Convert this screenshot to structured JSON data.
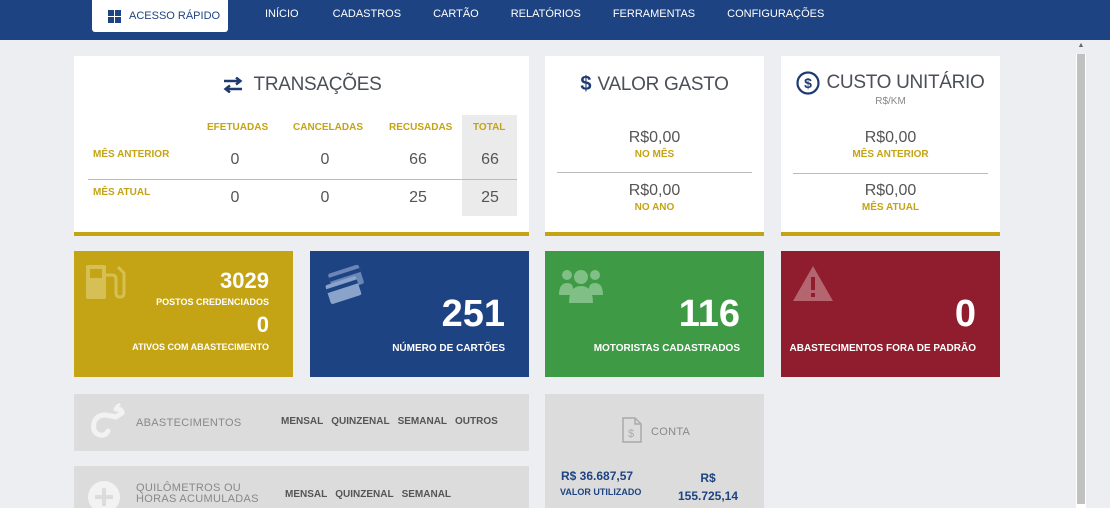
{
  "nav": {
    "quick_access": "ACESSO RÁPIDO",
    "items": [
      "INÍCIO",
      "CADASTROS",
      "CARTÃO",
      "RELATÓRIOS",
      "FERRAMENTAS",
      "CONFIGURAÇÕES"
    ]
  },
  "transacoes": {
    "title": "TRANSAÇÕES",
    "headers": [
      "EFETUADAS",
      "CANCELADAS",
      "RECUSADAS",
      "TOTAL"
    ],
    "rows": [
      {
        "label": "MÊS ANTERIOR",
        "values": [
          "0",
          "0",
          "66",
          "66"
        ]
      },
      {
        "label": "MÊS ATUAL",
        "values": [
          "0",
          "0",
          "25",
          "25"
        ]
      }
    ]
  },
  "valor_gasto": {
    "title": "VALOR GASTO",
    "items": [
      {
        "value": "R$0,00",
        "label": "NO MÊS"
      },
      {
        "value": "R$0,00",
        "label": "NO ANO"
      }
    ]
  },
  "custo_unitario": {
    "title": "CUSTO UNITÁRIO",
    "unit": "R$/KM",
    "items": [
      {
        "value": "R$0,00",
        "label": "MÊS ANTERIOR"
      },
      {
        "value": "R$0,00",
        "label": "MÊS ATUAL"
      }
    ]
  },
  "tiles": {
    "postos": {
      "value1": "3029",
      "label1": "POSTOS CREDENCIADOS",
      "value2": "0",
      "label2": "ATIVOS COM ABASTECIMENTO",
      "color": "#c4a414"
    },
    "cartoes": {
      "value": "251",
      "label": "NÚMERO DE CARTÕES",
      "color": "#1e4382"
    },
    "motoristas": {
      "value": "116",
      "label": "MOTORISTAS CADASTRADOS",
      "color": "#3f9a45"
    },
    "fora_padrao": {
      "value": "0",
      "label": "ABASTECIMENTOS FORA DE PADRÃO",
      "color": "#8f1d2d"
    }
  },
  "abastecimentos": {
    "label": "ABASTECIMENTOS",
    "options": [
      "MENSAL",
      "QUINZENAL",
      "SEMANAL",
      "OUTROS"
    ]
  },
  "quilometros": {
    "label_line1": "QUILÔMETROS OU",
    "label_line2": "HORAS ACUMULADAS",
    "options": [
      "MENSAL",
      "QUINZENAL",
      "SEMANAL"
    ]
  },
  "conta": {
    "label": "CONTA",
    "used_value": "R$ 36.687,57",
    "used_label": "VALOR UTILIZADO",
    "limit_value_line1": "R$",
    "limit_value_line2": "155.725,14"
  }
}
